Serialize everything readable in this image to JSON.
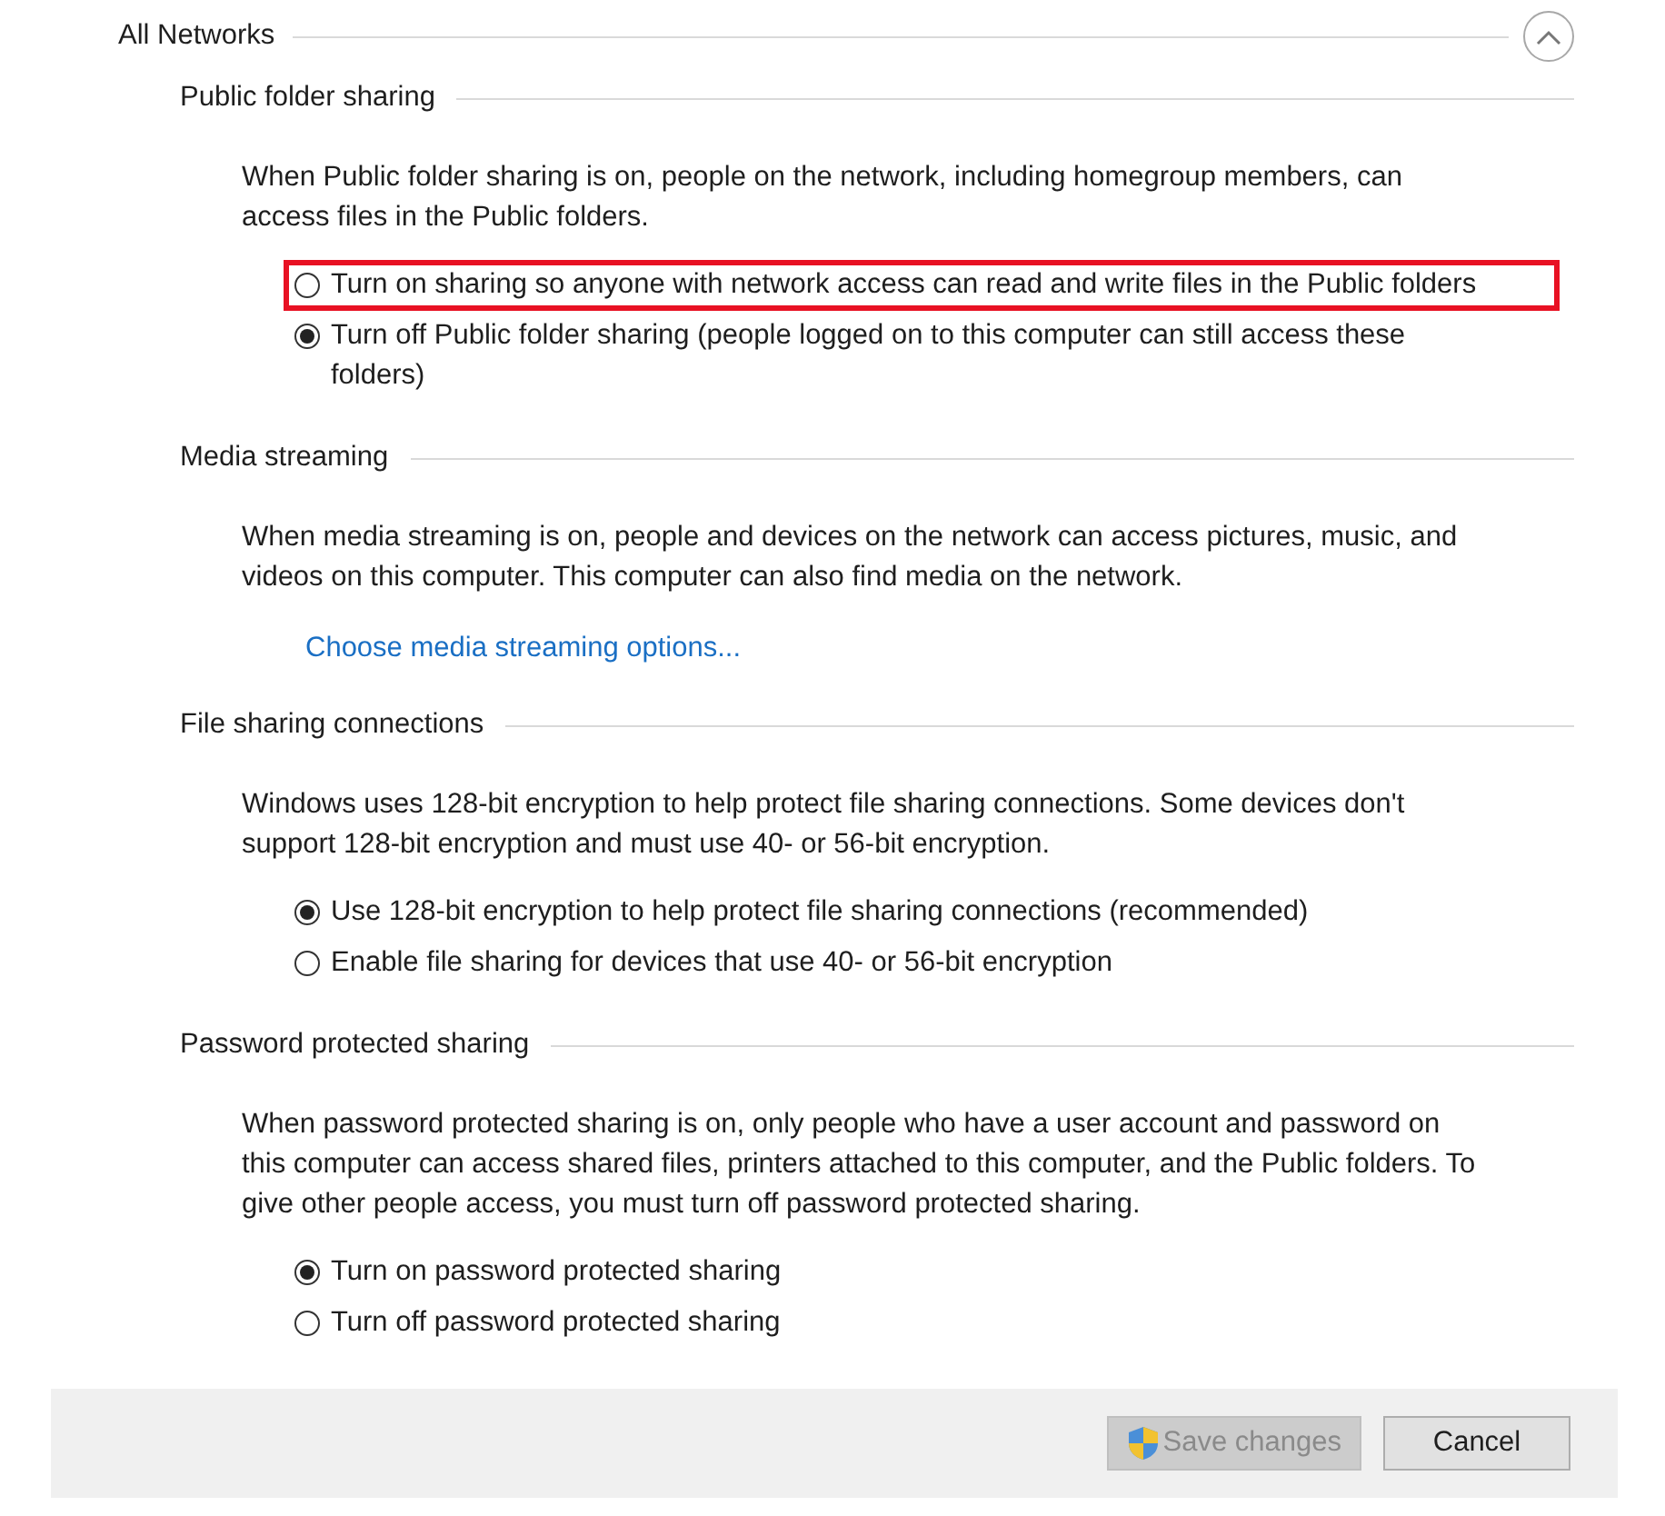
{
  "header": {
    "title": "All Networks",
    "expanded": true
  },
  "sections": [
    {
      "title": "Public folder sharing",
      "description": "When Public folder sharing is on, people on the network, including homegroup members, can access files in the Public folders.",
      "options": [
        {
          "label": "Turn on sharing so anyone with network access can read and write files in the Public folders",
          "selected": false,
          "highlighted": true
        },
        {
          "label": "Turn off Public folder sharing (people logged on to this computer can still access these folders)",
          "selected": true,
          "highlighted": false
        }
      ]
    },
    {
      "title": "Media streaming",
      "description": "When media streaming is on, people and devices on the network can access pictures, music, and videos on this computer. This computer can also find media on the network.",
      "link": "Choose media streaming options..."
    },
    {
      "title": "File sharing connections",
      "description": "Windows uses 128-bit encryption to help protect file sharing connections. Some devices don't support 128-bit encryption and must use 40- or 56-bit encryption.",
      "options": [
        {
          "label": "Use 128-bit encryption to help protect file sharing connections (recommended)",
          "selected": true,
          "highlighted": false
        },
        {
          "label": "Enable file sharing for devices that use 40- or 56-bit encryption",
          "selected": false,
          "highlighted": false
        }
      ]
    },
    {
      "title": "Password protected sharing",
      "description": "When password protected sharing is on, only people who have a user account and password on this computer can access shared files, printers attached to this computer, and the Public folders. To give other people access, you must turn off password protected sharing.",
      "options": [
        {
          "label": "Turn on password protected sharing",
          "selected": true,
          "highlighted": false
        },
        {
          "label": "Turn off password protected sharing",
          "selected": false,
          "highlighted": false
        }
      ]
    }
  ],
  "buttons": [
    {
      "label": "Save changes",
      "kind": "admin",
      "disabled": true
    },
    {
      "label": "Cancel",
      "kind": "plain",
      "disabled": false
    }
  ]
}
